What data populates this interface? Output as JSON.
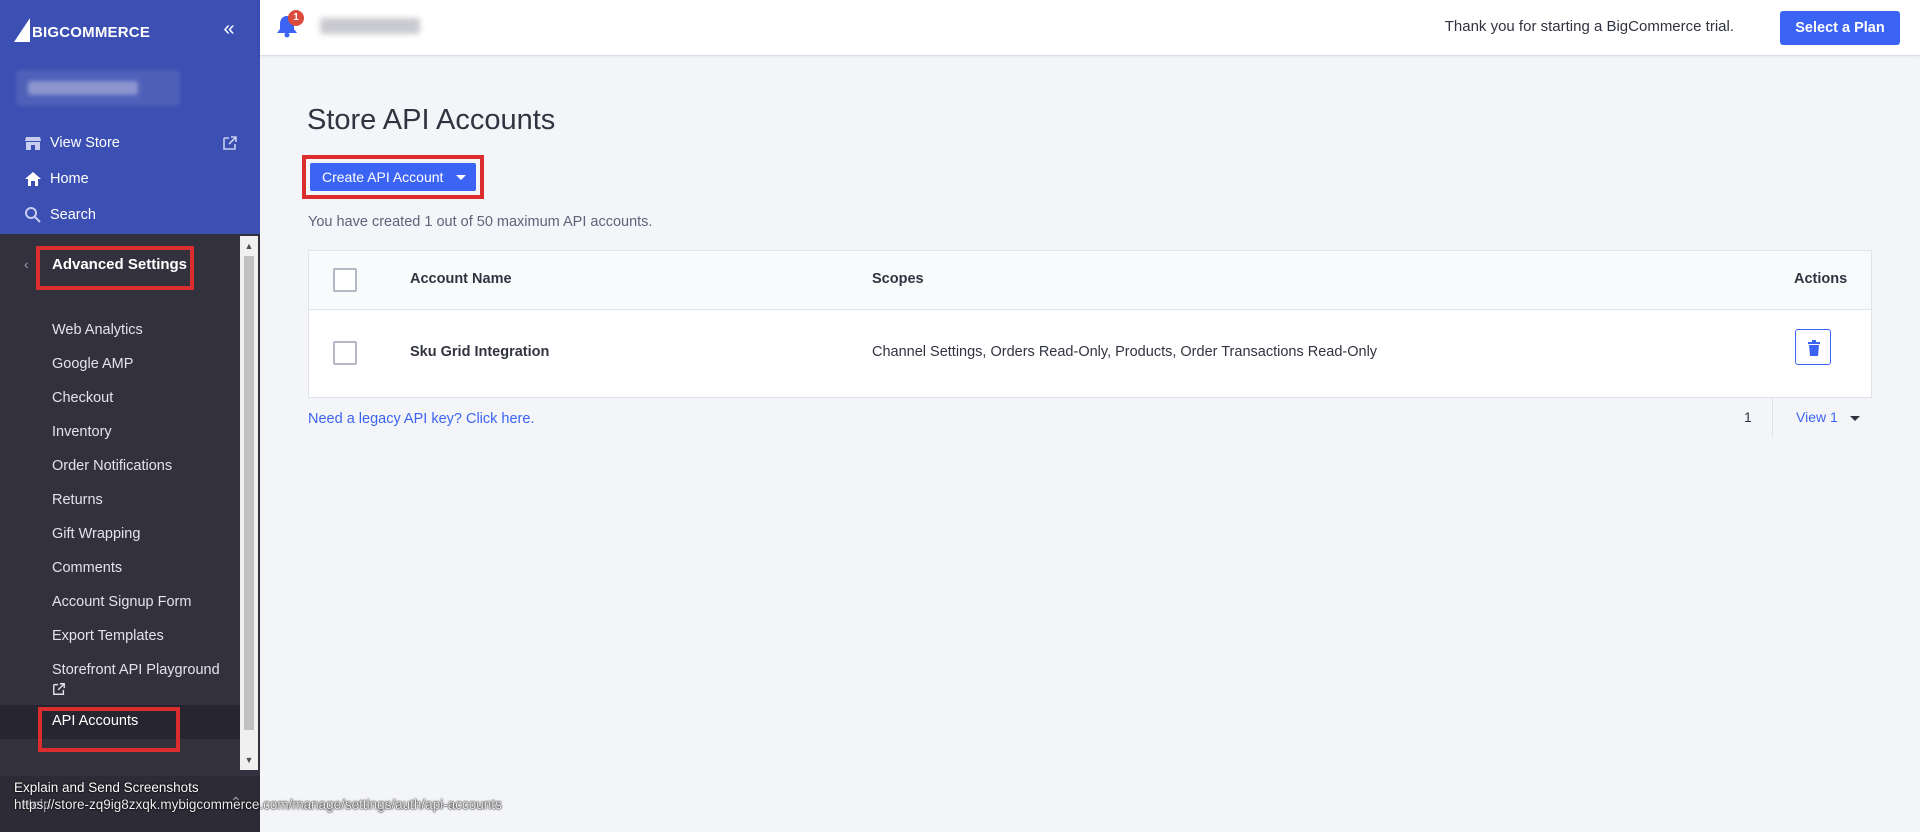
{
  "brand": {
    "name": "BIGCOMMERCE"
  },
  "sidebar": {
    "top_links": [
      {
        "label": "View Store",
        "icon": "storefront-icon"
      },
      {
        "label": "Home",
        "icon": "home-icon"
      },
      {
        "label": "Search",
        "icon": "search-icon"
      }
    ],
    "section_title": "Advanced Settings",
    "items": [
      {
        "label": "Web Analytics"
      },
      {
        "label": "Google AMP"
      },
      {
        "label": "Checkout"
      },
      {
        "label": "Inventory"
      },
      {
        "label": "Order Notifications"
      },
      {
        "label": "Returns"
      },
      {
        "label": "Gift Wrapping"
      },
      {
        "label": "Comments"
      },
      {
        "label": "Account Signup Form"
      },
      {
        "label": "Export Templates"
      },
      {
        "label": "Storefront API Playground"
      },
      {
        "label": "API Accounts"
      }
    ],
    "help_label": "Help"
  },
  "header": {
    "notification_count": "1",
    "trial_text": "Thank you for starting a BigCommerce trial.",
    "select_plan_label": "Select a Plan"
  },
  "main": {
    "title": "Store API Accounts",
    "create_button_label": "Create API Account",
    "info_text": "You have created 1 out of 50 maximum API accounts.",
    "table": {
      "columns": [
        "Account Name",
        "Scopes",
        "Actions"
      ],
      "rows": [
        {
          "name": "Sku Grid Integration",
          "scopes": "Channel Settings, Orders Read-Only, Products, Order Transactions Read-Only"
        }
      ]
    },
    "legacy_link": "Need a legacy API key? Click here.",
    "pagination": {
      "page": "1",
      "view_label": "View 1"
    }
  },
  "status_overlay": {
    "line1": "Explain and Send Screenshots",
    "line2": "https://store-zq9ig8zxqk.mybigcommerce.com/manage/settings/auth/api-accounts"
  },
  "colors": {
    "sidebar_top": "#3c4fb2",
    "sidebar_bg": "#34313f",
    "primary": "#3c64f4",
    "highlight": "#db2d2d",
    "badge": "#db4c3f"
  }
}
